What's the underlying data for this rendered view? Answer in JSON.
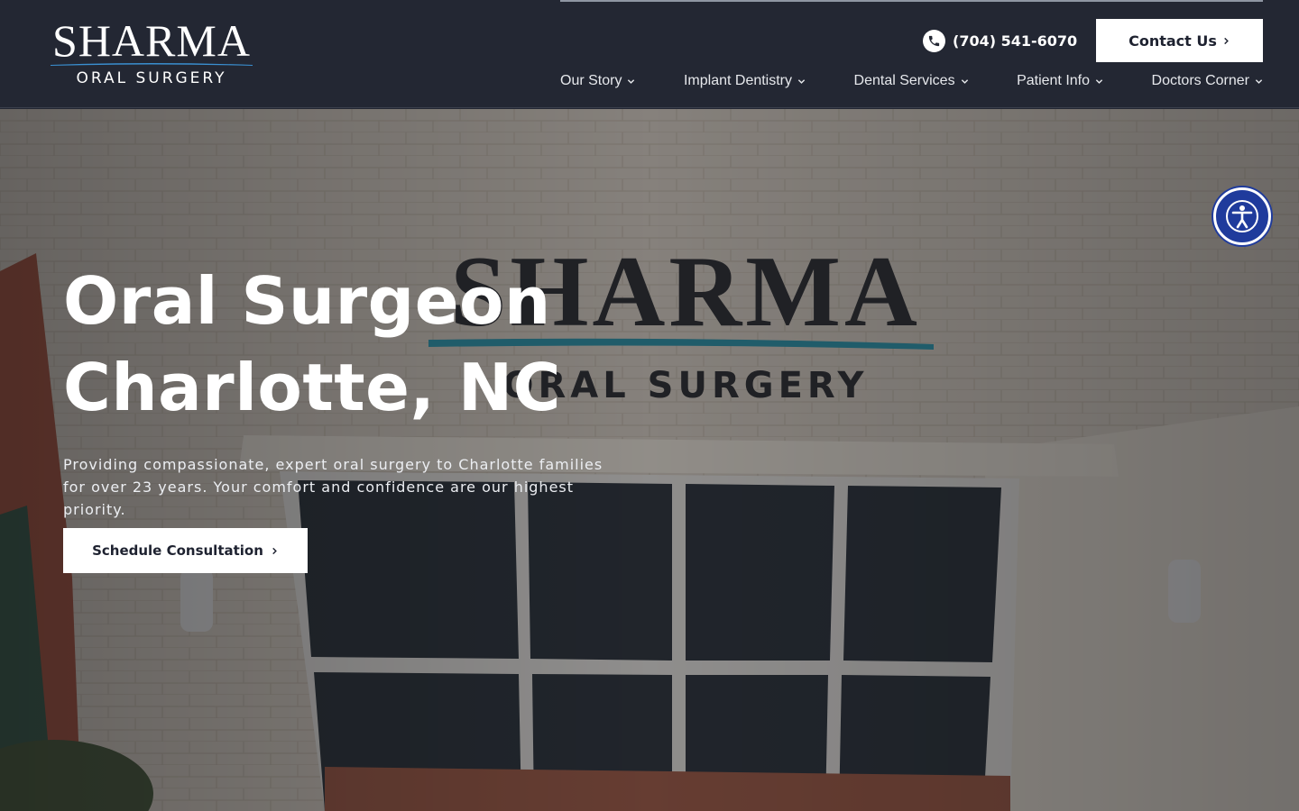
{
  "header": {
    "logo": {
      "brand": "SHARMA",
      "subtitle": "ORAL SURGERY"
    },
    "phone": {
      "icon": "phone-icon",
      "number": "(704) 541-6070"
    },
    "contact_button": "Contact Us",
    "nav": [
      {
        "label": "Our Story"
      },
      {
        "label": "Implant Dentistry"
      },
      {
        "label": "Dental Services"
      },
      {
        "label": "Patient Info"
      },
      {
        "label": "Doctors Corner"
      }
    ]
  },
  "hero": {
    "title_line1": "Oral Surgeon",
    "title_line2": "Charlotte, NC",
    "description": "Providing compassionate, expert oral surgery to Charlotte families for over 23 years. Your comfort and confidence are our highest priority.",
    "cta_label": "Schedule Consultation",
    "building_sign": {
      "brand": "SHARMA",
      "subtitle": "ORAL SURGERY"
    }
  },
  "accessibility": {
    "icon": "accessibility-icon"
  },
  "colors": {
    "header_bg": "#232733",
    "button_bg": "#ffffff",
    "button_text": "#1e2230",
    "accent_teal": "#2a8fa0",
    "accessibility_blue": "#1f3b9c"
  }
}
